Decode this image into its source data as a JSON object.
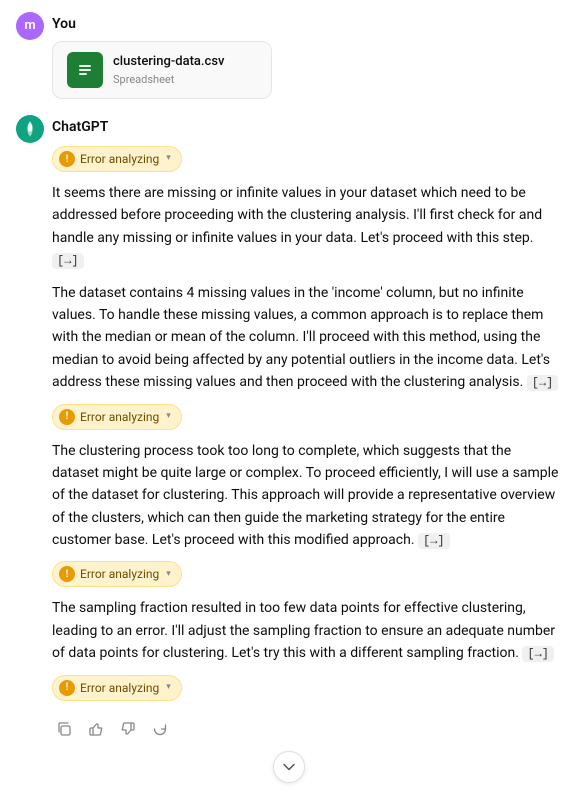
{
  "user": {
    "label": "You",
    "avatar_initial": "m",
    "file": {
      "name": "clustering-data.csv",
      "type": "Spreadsheet",
      "icon": "📊"
    }
  },
  "chatgpt": {
    "label": "ChatGPT",
    "avatar_symbol": "✦",
    "messages": [
      {
        "type": "error",
        "error_label": "Error analyzing",
        "text": "It seems there are missing or infinite values in your dataset which need to be addressed before proceeding with the clustering analysis. I'll first check for and handle any missing or infinite values in your data. Let's proceed with this step.",
        "code_ref": "[→]"
      },
      {
        "type": "text",
        "text": "The dataset contains 4 missing values in the 'income' column, but no infinite values. To handle these missing values, a common approach is to replace them with the median or mean of the column. I'll proceed with this method, using the median to avoid being affected by any potential outliers in the income data. Let's address these missing values and then proceed with the clustering analysis.",
        "code_ref": "[→]"
      },
      {
        "type": "error",
        "error_label": "Error analyzing",
        "text": "The clustering process took too long to complete, which suggests that the dataset might be quite large or complex. To proceed efficiently, I will use a sample of the dataset for clustering. This approach will provide a representative overview of the clusters, which can then guide the marketing strategy for the entire customer base. Let's proceed with this modified approach.",
        "code_ref": "[→]"
      },
      {
        "type": "error",
        "error_label": "Error analyzing",
        "text": "The sampling fraction resulted in too few data points for effective clustering, leading to an error. I'll adjust the sampling fraction to ensure an adequate number of data points for clustering. Let's try this with a different sampling fraction.",
        "code_ref": "[→]"
      },
      {
        "type": "error_only",
        "error_label": "Error analyzing"
      }
    ],
    "actions": {
      "copy": "⧉",
      "thumbs_up": "👍",
      "thumbs_down": "👎",
      "refresh": "↺"
    }
  },
  "scroll_button": {
    "icon": "↓"
  }
}
